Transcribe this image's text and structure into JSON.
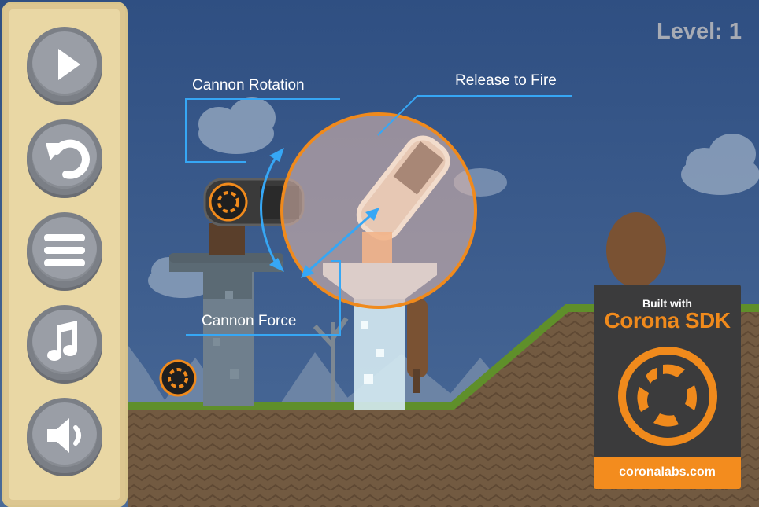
{
  "hud": {
    "level_text": "Level: 1"
  },
  "menu": {
    "buttons": [
      {
        "name": "play-button",
        "icon": "play-icon"
      },
      {
        "name": "restart-button",
        "icon": "restart-icon"
      },
      {
        "name": "menu-button",
        "icon": "menu-icon"
      },
      {
        "name": "music-button",
        "icon": "music-note-icon"
      },
      {
        "name": "sound-button",
        "icon": "speaker-icon"
      }
    ]
  },
  "tutorial": {
    "rotation_label": "Cannon Rotation",
    "fire_label": "Release to Fire",
    "force_label": "Cannon Force"
  },
  "badge": {
    "built_with": "Built with",
    "product": "Corona SDK",
    "url": "coronalabs.com"
  },
  "colors": {
    "sky": "#3a5a8c",
    "panel": "#e9d7a4",
    "accent_orange": "#f08a1c",
    "callout_blue": "#36a7f5",
    "grass": "#5f8f2a",
    "dirt": "#6e553e"
  }
}
